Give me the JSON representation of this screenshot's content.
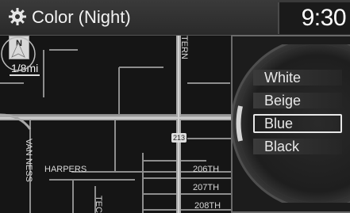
{
  "header": {
    "title": "Color (Night)",
    "time": "9:30",
    "settings_icon": "gear-icon"
  },
  "map": {
    "scale": "1/8mi",
    "north_icon": "north-up-compass-icon",
    "vehicle_icon": "vehicle-position-arrow-icon",
    "route_shield": "213",
    "streets": {
      "tern": "TERN",
      "van_ness": "VAN NESS",
      "harpers": "HARPERS",
      "s206": "206TH",
      "s207": "207TH",
      "s208": "208TH",
      "tec": "TEC"
    }
  },
  "color_menu": {
    "items": [
      {
        "label": "White",
        "selected": false
      },
      {
        "label": "Beige",
        "selected": false
      },
      {
        "label": "Blue",
        "selected": true
      },
      {
        "label": "Black",
        "selected": false
      }
    ]
  }
}
